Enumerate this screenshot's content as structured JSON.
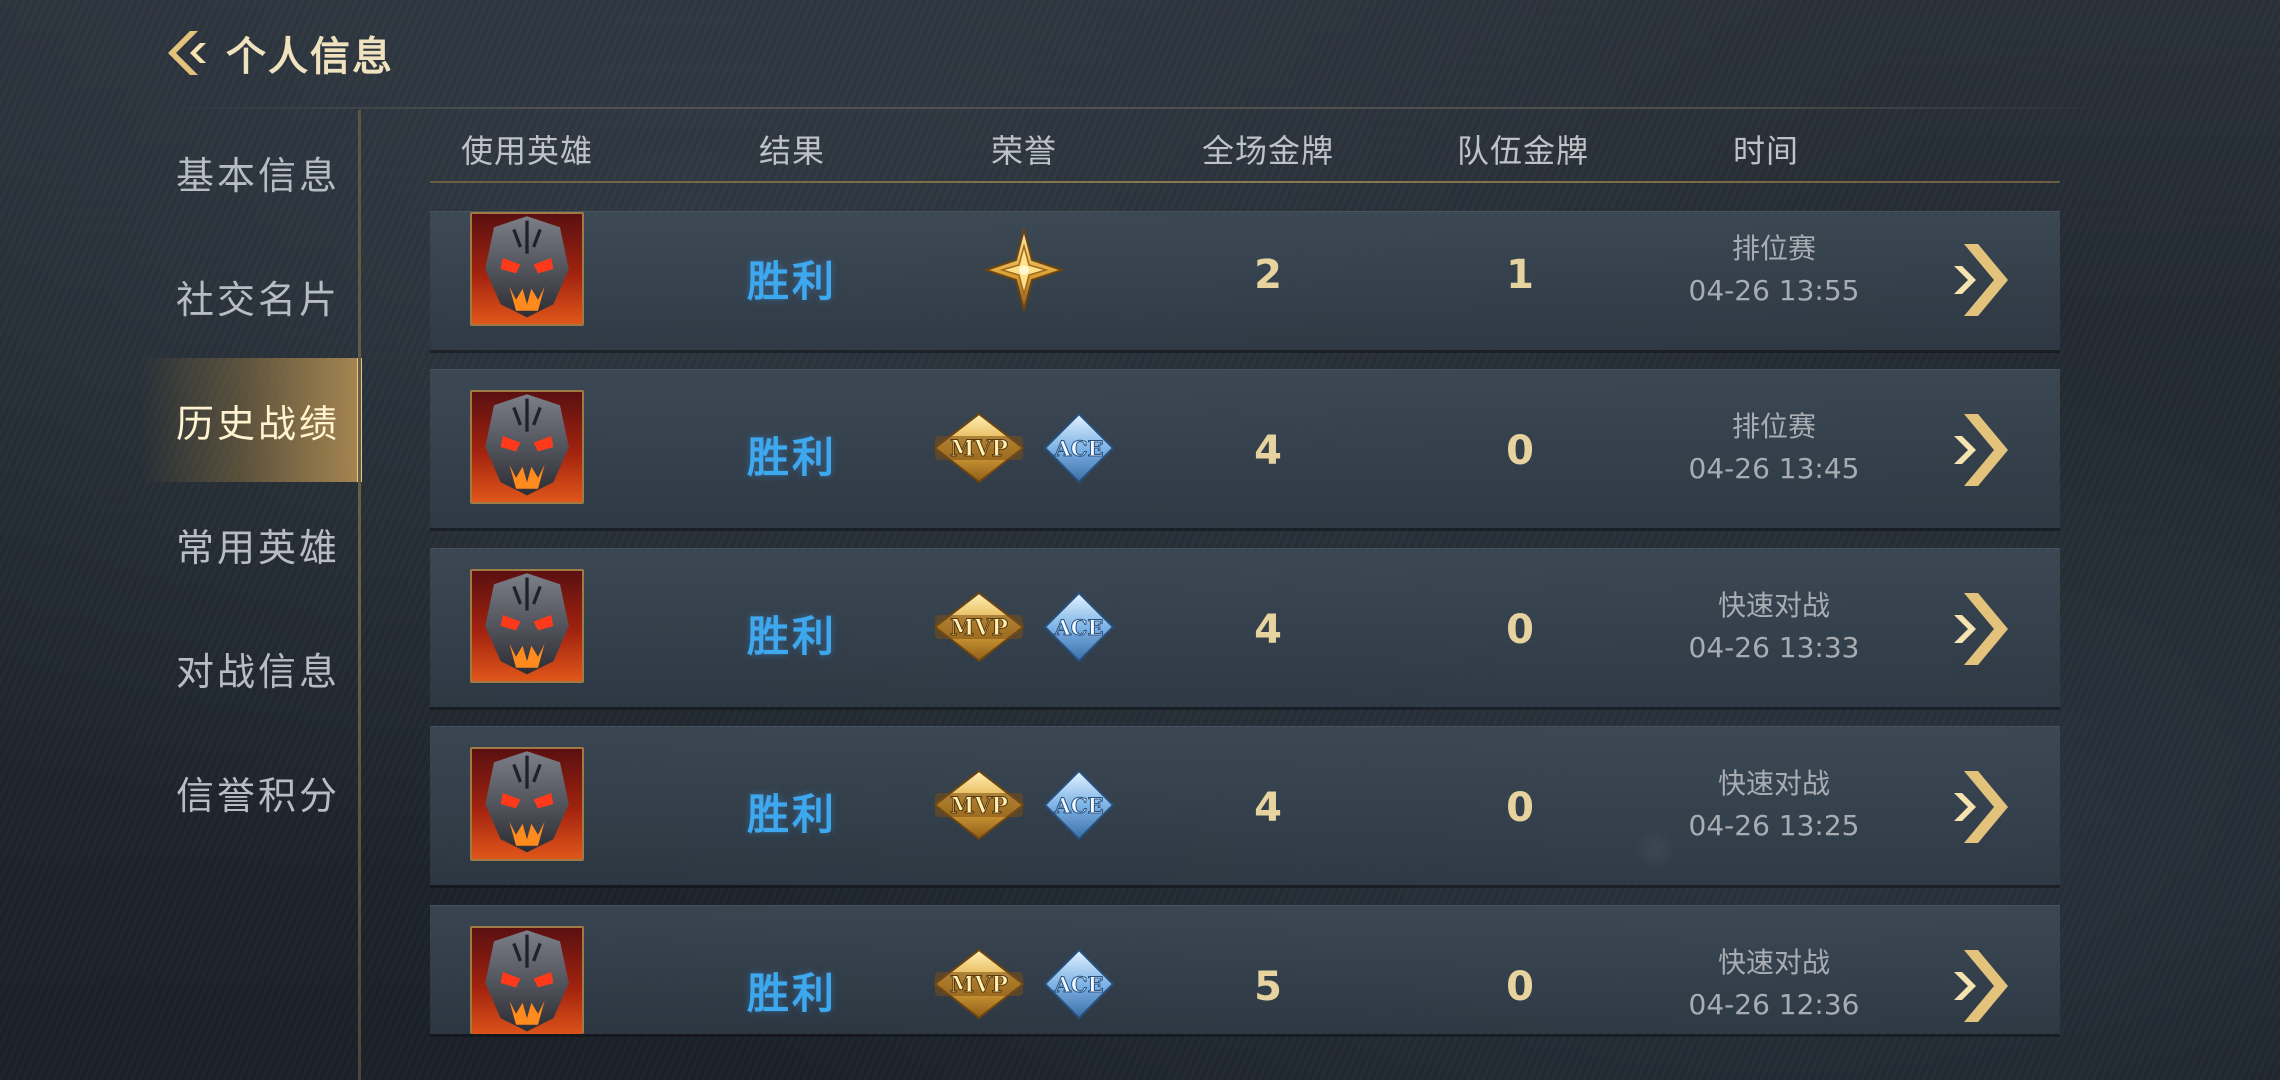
{
  "header": {
    "title": "个人信息"
  },
  "sidebar": {
    "items": [
      {
        "label": "基本信息",
        "active": false
      },
      {
        "label": "社交名片",
        "active": false
      },
      {
        "label": "历史战绩",
        "active": true
      },
      {
        "label": "常用英雄",
        "active": false
      },
      {
        "label": "对战信息",
        "active": false
      },
      {
        "label": "信誉积分",
        "active": false
      }
    ]
  },
  "table": {
    "columns": [
      "使用英雄",
      "结果",
      "荣誉",
      "全场金牌",
      "队伍金牌",
      "时间"
    ],
    "rows": [
      {
        "hero_icon": "hero-portrait-icon",
        "result": "胜利",
        "honors": [
          "star-medal-icon"
        ],
        "match_gold": "2",
        "team_gold": "1",
        "mode": "排位赛",
        "time": "04-26 13:55"
      },
      {
        "hero_icon": "hero-portrait-icon",
        "result": "胜利",
        "honors": [
          "mvp-badge-icon",
          "ace-badge-icon"
        ],
        "match_gold": "4",
        "team_gold": "0",
        "mode": "排位赛",
        "time": "04-26 13:45"
      },
      {
        "hero_icon": "hero-portrait-icon",
        "result": "胜利",
        "honors": [
          "mvp-badge-icon",
          "ace-badge-icon"
        ],
        "match_gold": "4",
        "team_gold": "0",
        "mode": "快速对战",
        "time": "04-26 13:33"
      },
      {
        "hero_icon": "hero-portrait-icon",
        "result": "胜利",
        "honors": [
          "mvp-badge-icon",
          "ace-badge-icon"
        ],
        "match_gold": "4",
        "team_gold": "0",
        "mode": "快速对战",
        "time": "04-26 13:25"
      },
      {
        "hero_icon": "hero-portrait-icon",
        "result": "胜利",
        "honors": [
          "mvp-badge-icon",
          "ace-badge-icon"
        ],
        "match_gold": "5",
        "team_gold": "0",
        "mode": "快速对战",
        "time": "04-26 12:36"
      }
    ]
  },
  "badges": {
    "mvp": "MVP",
    "ace": "ACE"
  },
  "colors": {
    "result_win": "#3ea8ef",
    "gold_text": "#e6d39f",
    "accent_gold": "#e9c77f"
  }
}
